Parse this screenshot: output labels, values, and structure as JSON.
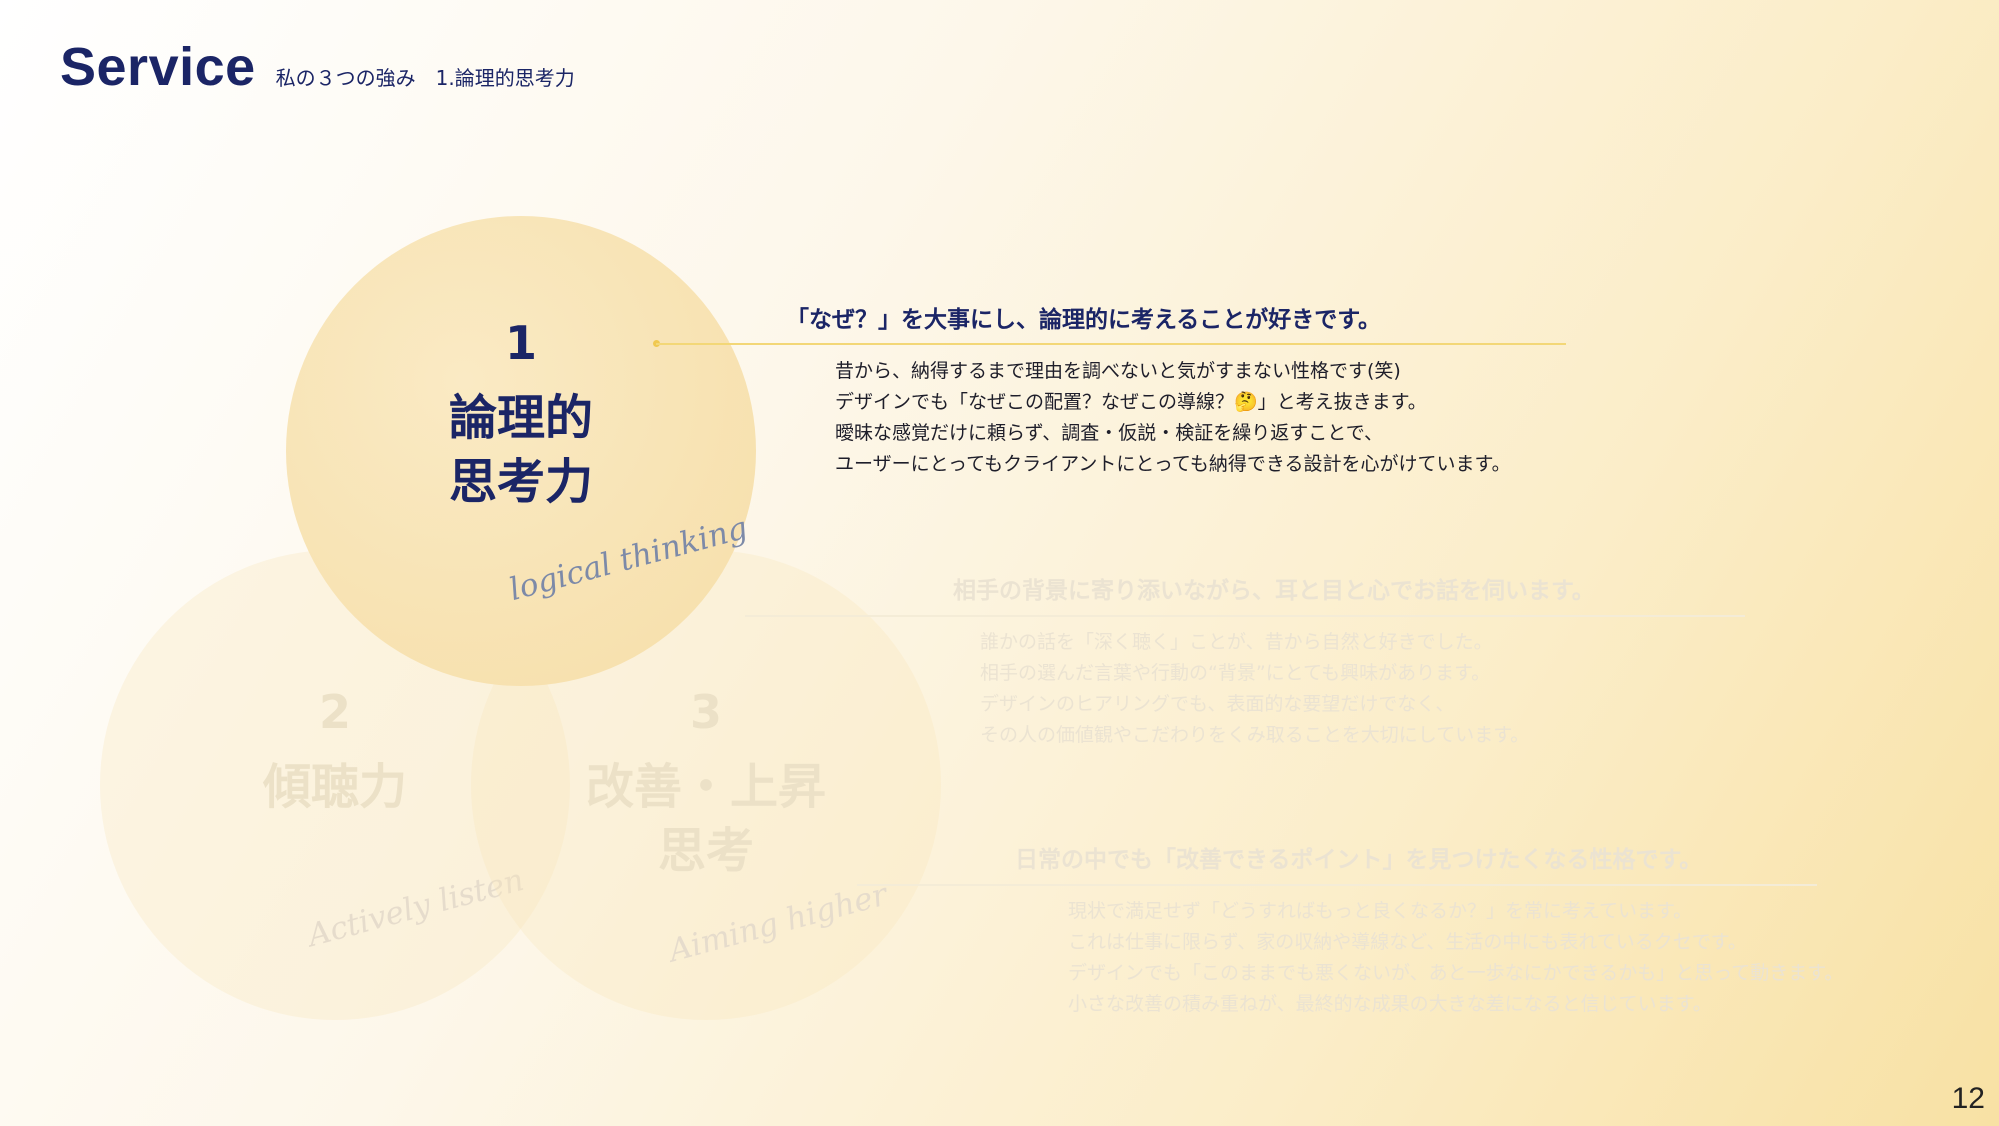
{
  "header": {
    "title": "Service",
    "subtitle": "私の３つの強み　1.論理的思考力"
  },
  "circles": [
    {
      "number": "1",
      "title_line1": "論理的",
      "title_line2": "思考力",
      "script": "logical thinking"
    },
    {
      "number": "2",
      "title_line1": "傾聴力",
      "title_line2": "",
      "script": "Actively listen"
    },
    {
      "number": "3",
      "title_line1": "改善・上昇",
      "title_line2": "思考",
      "script": "Aiming higher"
    }
  ],
  "blocks": [
    {
      "heading": "「なぜ？」を大事にし、論理的に考えることが好きです。",
      "lines": [
        "昔から、納得するまで理由を調べないと気がすまない性格です(笑)",
        "デザインでも「なぜこの配置？なぜこの導線？🤔」と考え抜きます。",
        "曖昧な感覚だけに頼らず、調査・仮説・検証を繰り返すことで、",
        "ユーザーにとってもクライアントにとっても納得できる設計を心がけています。"
      ]
    },
    {
      "heading": "相手の背景に寄り添いながら、耳と目と心でお話を伺います。",
      "lines": [
        "誰かの話を「深く聴く」ことが、昔から自然と好きでした。",
        "相手の選んだ言葉や行動の“背景”にとても興味があります。",
        "デザインのヒアリングでも、表面的な要望だけでなく、",
        "その人の価値観やこだわりをくみ取ることを大切にしています。"
      ]
    },
    {
      "heading": "日常の中でも「改善できるポイント」を見つけたくなる性格です。",
      "lines": [
        "現状で満足せず「どうすればもっと良くなるか？」を常に考えています。",
        "これは仕事に限らず、家の収納や導線など、生活の中にも表れているクセです。",
        "デザインでも「このままでも悪くないが、あと一歩なにかできるかも」と思って動きます。",
        "小さな改善の積み重ねが、最終的な成果の大きな差になると信じています。"
      ]
    }
  ],
  "page_number": "12"
}
